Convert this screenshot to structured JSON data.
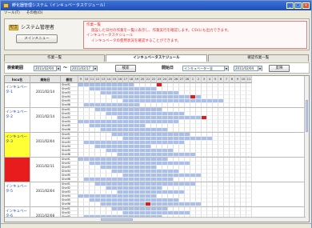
{
  "titlebar": {
    "title": "孵化器管理システム（インキュベータスケジュール）"
  },
  "menubar": {
    "items": [
      "ツール(T)",
      "その他(O)"
    ]
  },
  "header": {
    "role": "担当",
    "user_name": "システム管理者",
    "menu_button": "メインメニュー",
    "notice_lines": [
      "作業一覧",
      "施設した日付の作業を一覧に表示し、作業実行を確認します。CSVにも出力できます。",
      "インキュベータスケジュール",
      "インキュベータの使用状況を確認することができます。"
    ]
  },
  "tabs": [
    "作業一覧",
    "インキュベータスケジュール",
    "確認作業一覧"
  ],
  "toolbar": {
    "period_label": "検索範囲",
    "date_from": "2011/02/04",
    "separator": "～",
    "date_to": "2011/02/17",
    "search_button": "検索",
    "start_label": "開始日",
    "incubator_select": "インキュベーター全",
    "start_date": "2011/02/04",
    "apply_button": "反映"
  },
  "grid": {
    "headers": [
      "Incu名",
      "開始日",
      "棚位"
    ],
    "days": [
      "9",
      "10",
      "11",
      "12",
      "13",
      "14",
      "15",
      "16",
      "17",
      "18",
      "19",
      "20",
      "21",
      "22",
      "23",
      "24",
      "25",
      "26",
      "27",
      "28",
      "1",
      "2",
      "3",
      "4",
      "5",
      "6",
      "7",
      "8",
      "9",
      "10",
      "11"
    ],
    "incubators": [
      {
        "name": "インキュベータ-1",
        "date": "2011/02/14",
        "color": "#ffffff",
        "shelves": [
          "Shelf1",
          "Shelf2",
          "Shelf3",
          "Shelf4",
          "Shelf5",
          "Shelf6"
        ]
      },
      {
        "name": "インキュベータ-2",
        "date": "2011/02/14",
        "color": "#ffffff",
        "shelves": [
          "Shelf1",
          "Shelf2",
          "Shelf3",
          "Shelf4",
          "Shelf5",
          "Shelf6"
        ]
      },
      {
        "name": "インキュベータ-3",
        "date": "2011/02/04",
        "color": "#ffff33",
        "shelves": [
          "Shelf1",
          "Shelf2",
          "Shelf3",
          "Shelf4",
          "Shelf5",
          "Shelf6"
        ]
      },
      {
        "name": "",
        "date": "2011/02/11",
        "color": "#e81c1c",
        "shelves": [
          "Shelf1",
          "Shelf2",
          "Shelf3",
          "Shelf4",
          "Shelf5",
          "Shelf6"
        ]
      },
      {
        "name": "インキュベータ-5",
        "date": "2011/02/04",
        "color": "#ffffff",
        "shelves": [
          "Shelf1",
          "Shelf2",
          "Shelf3",
          "Shelf4",
          "Shelf5",
          "Shelf6"
        ]
      },
      {
        "name": "インキュベータ-6",
        "date": "2011/02/08",
        "color": "#ffffff",
        "shelves": [
          "Shelf1",
          "Shelf2",
          "Shelf3",
          "Shelf4",
          "Shelf5",
          "Shelf6"
        ]
      }
    ]
  },
  "colors": {
    "booked": "#a9c0ec",
    "alert": "#d81e1e",
    "highlight_yellow": "#ffff33",
    "highlight_red": "#e81c1c"
  }
}
